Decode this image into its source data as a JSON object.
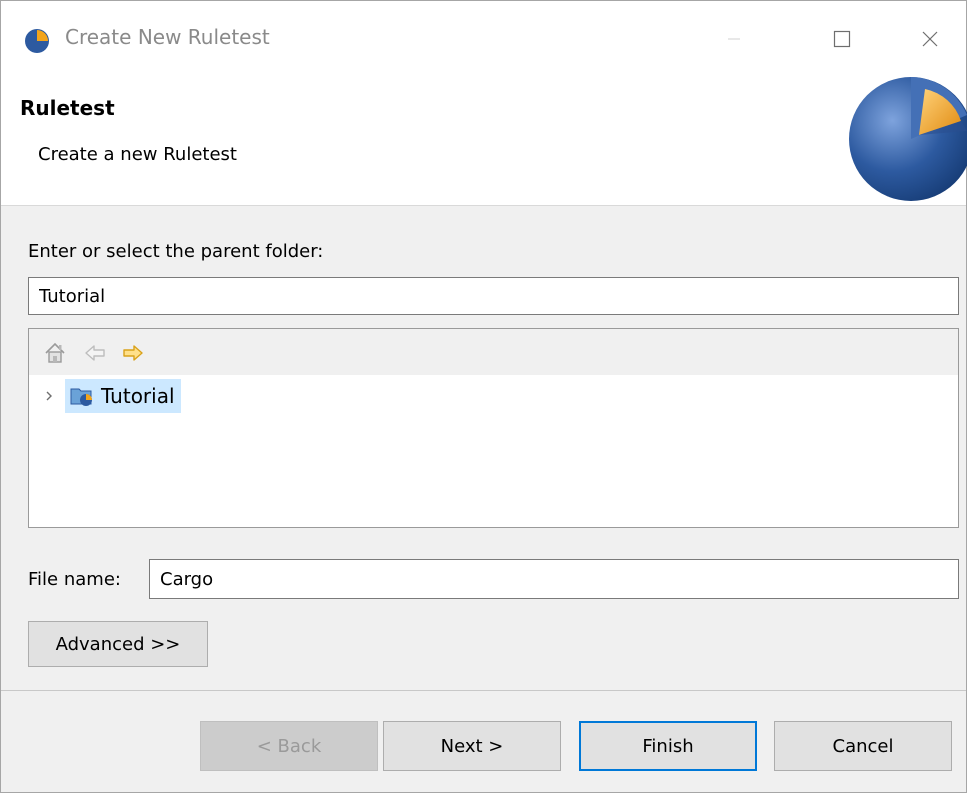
{
  "window": {
    "title": "Create New Ruletest",
    "icon": "ruletest-app-icon"
  },
  "window_controls": {
    "minimize_icon": "minimize-icon",
    "maximize_icon": "maximize-icon",
    "close_icon": "close-icon"
  },
  "banner": {
    "title": "Ruletest",
    "description": "Create a new Ruletest",
    "image": "ruletest-wizard-graphic"
  },
  "folder": {
    "label": "Enter or select the parent folder:",
    "value": "Tutorial"
  },
  "tree": {
    "toolbar": [
      "home-icon",
      "back-arrow-icon",
      "forward-arrow-icon"
    ],
    "items": [
      {
        "label": "Tutorial",
        "icon": "project-folder-icon",
        "selected": true,
        "expanded": false
      }
    ]
  },
  "filename": {
    "label": "File name:",
    "value": "Cargo"
  },
  "buttons": {
    "advanced": "Advanced >>",
    "back": "< Back",
    "next": "Next >",
    "finish": "Finish",
    "cancel": "Cancel"
  },
  "colors": {
    "accent": "#0078d7",
    "selection": "#cce8ff",
    "banner_globe": "#2d5aa0",
    "banner_wedge": "#f0a020"
  }
}
